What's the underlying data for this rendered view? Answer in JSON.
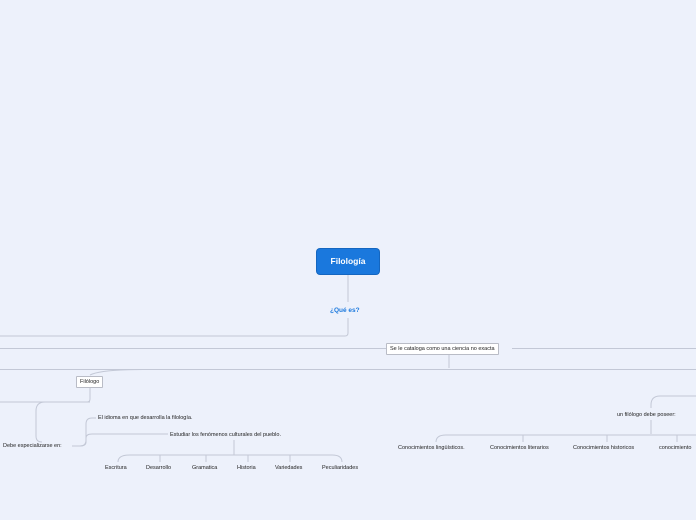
{
  "map": {
    "root": "Filología",
    "question": "¿Qué es?",
    "catalog": "Se le cataloga como una ciencia no exacta",
    "philologist": "Filólogo",
    "specialize": "Debe especializarse en:",
    "language": "El idioma en que desarrolla la filología.",
    "cultural": "Estudiar los fenómenos culturales del pueblo.",
    "phenomena": [
      "Escritura",
      "Desarrollo",
      "Gramatica",
      "Historia",
      "Variedades",
      "Peculiaridades"
    ],
    "must_have": "un filólogo debe poseer:",
    "knowledge": [
      "Conocimientos lingüísticos.",
      "Conocimientos literarios",
      "Conocimientos historicos",
      "conocimiento"
    ]
  },
  "colors": {
    "background": "#edf1fb",
    "root": "#1a78dd",
    "link": "#c3c8d6",
    "accent_text": "#1a78dd"
  }
}
